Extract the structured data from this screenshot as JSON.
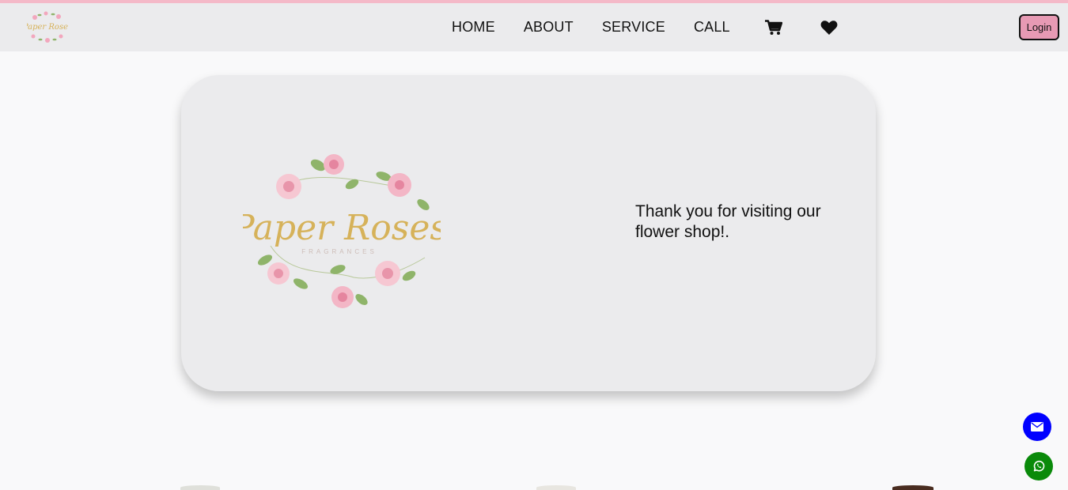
{
  "brand": {
    "logo_text": "Paper Roses",
    "logo_subtext": "FRAGRANCES"
  },
  "nav": {
    "links": [
      "HOME",
      "ABOUT",
      "SERVICE",
      "CALL"
    ],
    "cart_icon": "shopping-cart-icon",
    "favorites_icon": "heart-icon",
    "login_label": "Login"
  },
  "hero": {
    "message": "Thank you for visiting our flower shop!."
  },
  "floating": {
    "email_icon": "envelope-icon",
    "whatsapp_icon": "whatsapp-icon"
  },
  "colors": {
    "accent_pink": "#e79ab4",
    "stripe_pink": "#f4b9c8",
    "nav_bg": "#ebebed",
    "email_blue": "#0000ff",
    "whatsapp_green": "#0a8a0a",
    "logo_gold": "#d6b25a"
  }
}
